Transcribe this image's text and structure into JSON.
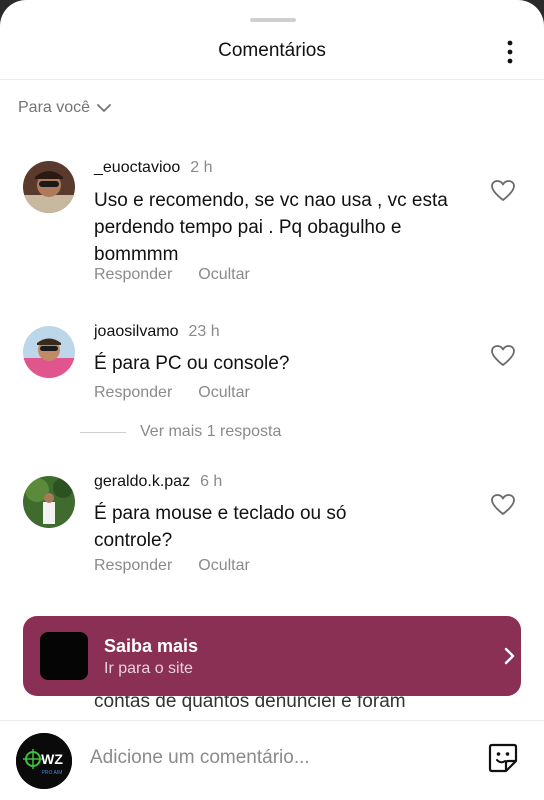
{
  "header": {
    "title": "Comentários"
  },
  "sort": {
    "label": "Para você"
  },
  "comments": [
    {
      "username": "_euoctavioo",
      "time": "2 h",
      "text": "Uso e recomendo, se vc nao usa , vc esta perdendo tempo pai . Pq obagulho e bommmm",
      "reply_label": "Responder",
      "hide_label": "Ocultar"
    },
    {
      "username": "joaosilvamo",
      "time": "23 h",
      "text": "É para PC ou console?",
      "reply_label": "Responder",
      "hide_label": "Ocultar",
      "view_replies": "Ver mais 1 resposta"
    },
    {
      "username": "geraldo.k.paz",
      "time": "6 h",
      "text": "É para mouse e teclado ou só controle?",
      "reply_label": "Responder",
      "hide_label": "Ocultar"
    }
  ],
  "partial_comment": {
    "text": "contas de quantos denunciei e foram"
  },
  "cta": {
    "title": "Saiba mais",
    "subtitle": "Ir para o site",
    "color": "#8a3055"
  },
  "composer": {
    "placeholder": "Adicione um comentário...",
    "avatar_text": "WZ",
    "avatar_subtext": "PRO AIM"
  },
  "icons": [
    "more-vertical-icon",
    "chevron-down-icon",
    "heart-icon",
    "chevron-right-icon",
    "sticker-icon"
  ]
}
